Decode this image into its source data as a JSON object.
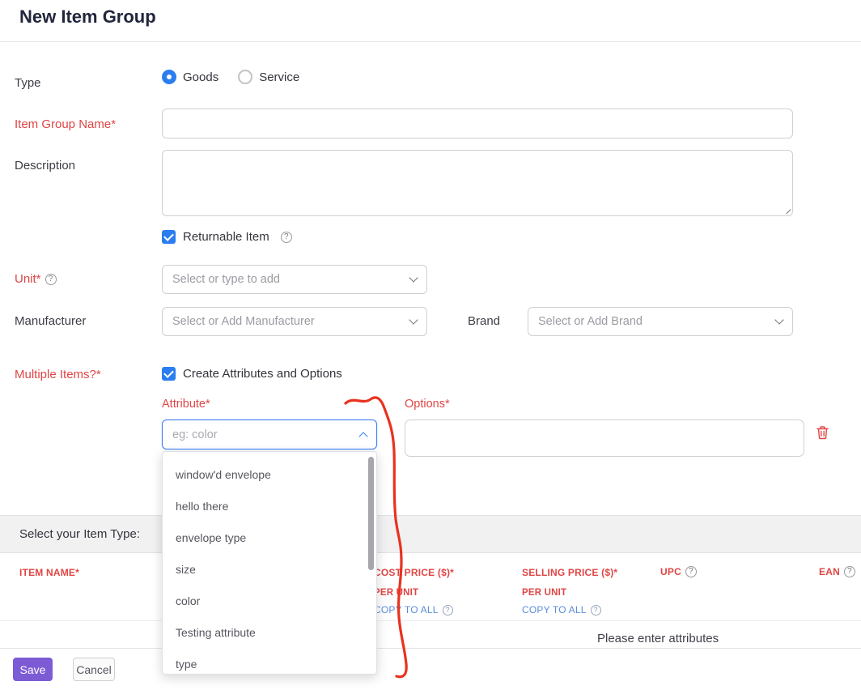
{
  "header": {
    "title": "New Item Group"
  },
  "form": {
    "type_label": "Type",
    "goods_label": "Goods",
    "service_label": "Service",
    "item_group_name_label": "Item Group Name*",
    "description_label": "Description",
    "returnable_label": "Returnable Item",
    "unit_label": "Unit*",
    "unit_placeholder": "Select or type to add",
    "manufacturer_label": "Manufacturer",
    "manufacturer_placeholder": "Select or Add Manufacturer",
    "brand_label": "Brand",
    "brand_placeholder": "Select or Add Brand",
    "multiple_items_label": "Multiple Items?*",
    "create_attributes_label": "Create Attributes and Options",
    "attribute_label": "Attribute*",
    "attribute_placeholder": "eg: color",
    "options_label": "Options*"
  },
  "attribute_dropdown": {
    "options": [
      "window'd envelope",
      "hello there",
      "envelope type",
      "size",
      "color",
      "Testing attribute",
      "type"
    ]
  },
  "item_type_section": {
    "label": "Select your Item Type:"
  },
  "table": {
    "item_name_header": "ITEM NAME*",
    "cost_price_header": "COST PRICE ($)*",
    "selling_price_header": "SELLING PRICE ($)*",
    "upc_header": "UPC",
    "ean_header": "EAN",
    "per_unit": "PER UNIT",
    "copy_to_all": "COPY TO ALL",
    "empty_message": "Please enter attributes"
  },
  "footer": {
    "save_label": "Save",
    "cancel_label": "Cancel"
  },
  "icons": {
    "help_glyph": "?"
  },
  "state": {
    "type_selected": "Goods",
    "returnable_checked": true,
    "create_attributes_checked": true
  },
  "colors": {
    "required_red": "#e04545",
    "link_blue": "#5a8dd8",
    "primary_blue": "#2b7df0",
    "save_purple": "#7d5bd5",
    "annotation_red": "#e8321f"
  }
}
